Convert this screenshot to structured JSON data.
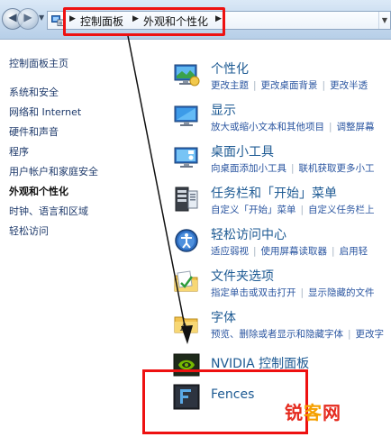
{
  "address_bar": {
    "crumbs": [
      "控制面板",
      "外观和个性化"
    ]
  },
  "left_nav": {
    "items": [
      {
        "label": "控制面板主页",
        "current": false
      },
      {
        "label": "系统和安全",
        "current": false
      },
      {
        "label": "网络和 Internet",
        "current": false
      },
      {
        "label": "硬件和声音",
        "current": false
      },
      {
        "label": "程序",
        "current": false
      },
      {
        "label": "用户帐户和家庭安全",
        "current": false
      },
      {
        "label": "外观和个性化",
        "current": true
      },
      {
        "label": "时钟、语言和区域",
        "current": false
      },
      {
        "label": "轻松访问",
        "current": false
      }
    ]
  },
  "categories": [
    {
      "title": "个性化",
      "icon": "personalization-icon",
      "links": [
        "更改主题",
        "更改桌面背景",
        "更改半透"
      ]
    },
    {
      "title": "显示",
      "icon": "display-icon",
      "links": [
        "放大或缩小文本和其他项目",
        "调整屏幕"
      ]
    },
    {
      "title": "桌面小工具",
      "icon": "gadgets-icon",
      "links": [
        "向桌面添加小工具",
        "联机获取更多小工"
      ]
    },
    {
      "title": "任务栏和「开始」菜单",
      "icon": "taskbar-icon",
      "links": [
        "自定义「开始」菜单",
        "自定义任务栏上"
      ]
    },
    {
      "title": "轻松访问中心",
      "icon": "ease-of-access-icon",
      "links": [
        "适应弱视",
        "使用屏幕读取器",
        "启用轻"
      ]
    },
    {
      "title": "文件夹选项",
      "icon": "folder-options-icon",
      "links": [
        "指定单击或双击打开",
        "显示隐藏的文件"
      ]
    },
    {
      "title": "字体",
      "icon": "fonts-icon",
      "links": [
        "预览、删除或者显示和隐藏字体",
        "更改字"
      ]
    },
    {
      "title": "NVIDIA 控制面板",
      "icon": "nvidia-icon",
      "links": []
    },
    {
      "title": "Fences",
      "icon": "fences-icon",
      "links": []
    }
  ],
  "watermark": {
    "part1": "锐",
    "part2": "客",
    "part3": "网"
  },
  "colors": {
    "annotation": "#ee1111",
    "link": "#2a55a0",
    "title": "#1d5a93"
  }
}
